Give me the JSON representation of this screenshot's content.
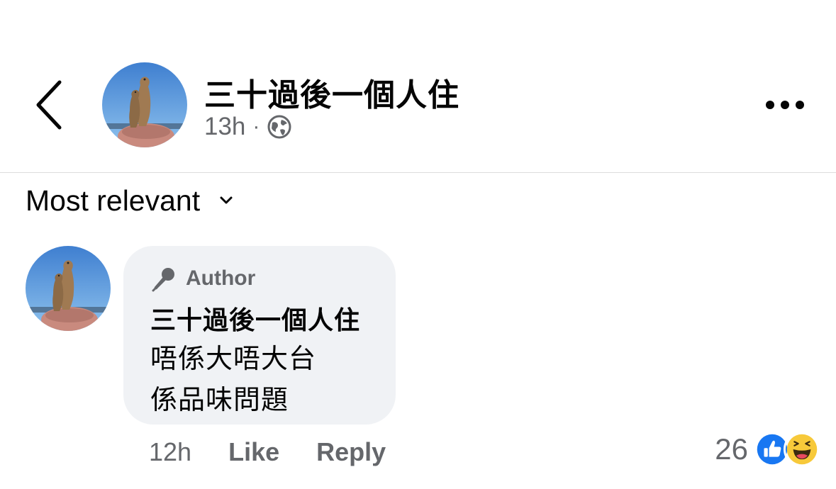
{
  "header": {
    "page_name": "三十過後一個人住",
    "time": "13h",
    "separator": "·",
    "privacy_icon": "globe-icon"
  },
  "sort": {
    "label": "Most relevant",
    "icon": "chevron-down-icon"
  },
  "comment": {
    "badge_label": "Author",
    "badge_icon": "microphone-icon",
    "author": "三十過後一個人住",
    "lines": [
      "唔係大唔大台",
      "係品味問題"
    ],
    "time": "12h",
    "like_label": "Like",
    "reply_label": "Reply",
    "reaction_count": "26",
    "reactions": [
      "like-reaction-icon",
      "haha-reaction-icon"
    ]
  },
  "colors": {
    "bubble_bg": "#f0f2f5",
    "muted_text": "#65676b",
    "like_blue": "#1877f2",
    "haha_yellow": "#f7c93a"
  }
}
